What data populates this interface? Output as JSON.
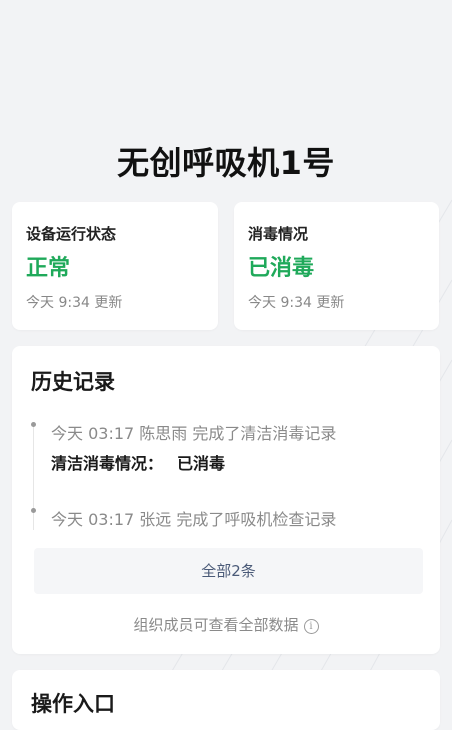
{
  "page": {
    "title": "无创呼吸机1号"
  },
  "status_cards": [
    {
      "label": "设备运行状态",
      "value": "正常",
      "time": "今天 9:34 更新"
    },
    {
      "label": "消毒情况",
      "value": "已消毒",
      "time": "今天 9:34 更新"
    }
  ],
  "history": {
    "title": "历史记录",
    "entries": [
      {
        "text": "今天 03:17  陈思雨 完成了清洁消毒记录",
        "detail_label": "清洁消毒情况：",
        "detail_value": "已消毒"
      },
      {
        "text": "今天 03:17  张远 完成了呼吸机检查记录"
      }
    ],
    "all_button": "全部2条",
    "footnote": "组织成员可查看全部数据",
    "info_icon": "i"
  },
  "operations": {
    "title": "操作入口"
  },
  "colors": {
    "status_green": "#1fa95a",
    "background": "#f2f3f5",
    "link": "#4a5a78"
  }
}
